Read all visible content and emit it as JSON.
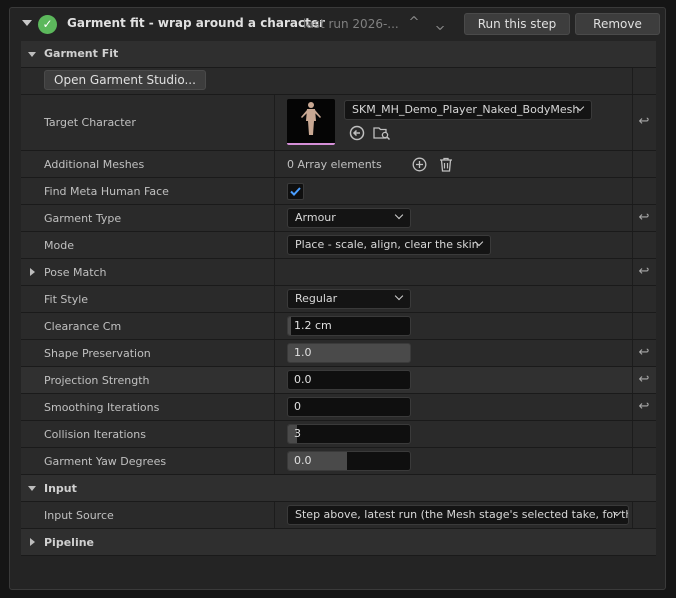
{
  "header": {
    "title": "Garment fit - wrap around a character",
    "subtitle": "last run 2026-...",
    "run_button": "Run this step",
    "remove_button": "Remove"
  },
  "sections": {
    "garment_fit": "Garment Fit",
    "input": "Input",
    "pipeline": "Pipeline"
  },
  "garment_fit": {
    "open_studio_button": "Open Garment Studio...",
    "target_character_label": "Target Character",
    "target_character_value": "SKM_MH_Demo_Player_Naked_BodyMesh",
    "additional_meshes_label": "Additional Meshes",
    "additional_meshes_value": "0 Array elements",
    "find_metahuman_face_label": "Find Meta Human Face",
    "find_metahuman_face_checked": true,
    "garment_type_label": "Garment Type",
    "garment_type_value": "Armour",
    "mode_label": "Mode",
    "mode_value": "Place - scale, align, clear the skin",
    "pose_match_label": "Pose Match",
    "fit_style_label": "Fit Style",
    "fit_style_value": "Regular",
    "clearance_label": "Clearance Cm",
    "clearance_value": "1.2 cm",
    "shape_preservation_label": "Shape Preservation",
    "shape_preservation_value": "1.0",
    "shape_preservation_fraction": 1.0,
    "projection_strength_label": "Projection Strength",
    "projection_strength_value": "0.0",
    "smoothing_iterations_label": "Smoothing Iterations",
    "smoothing_iterations_value": "0",
    "collision_iterations_label": "Collision Iterations",
    "collision_iterations_value": "3",
    "garment_yaw_label": "Garment Yaw Degrees",
    "garment_yaw_value": "0.0",
    "garment_yaw_fraction": 0.5
  },
  "input": {
    "input_source_label": "Input Source",
    "input_source_value": "Step above, latest run (the Mesh stage's selected take, for the"
  },
  "icons": {
    "success": "check-circle-icon",
    "reset": "reset-arrow-icon",
    "browse": "browse-icon",
    "use_selected": "use-selected-icon",
    "add": "add-icon",
    "delete": "trash-icon"
  },
  "colors": {
    "success": "#5cb85c",
    "checkbox_check": "#4a9eff",
    "thumbnail_underline": "#d58fd8"
  }
}
